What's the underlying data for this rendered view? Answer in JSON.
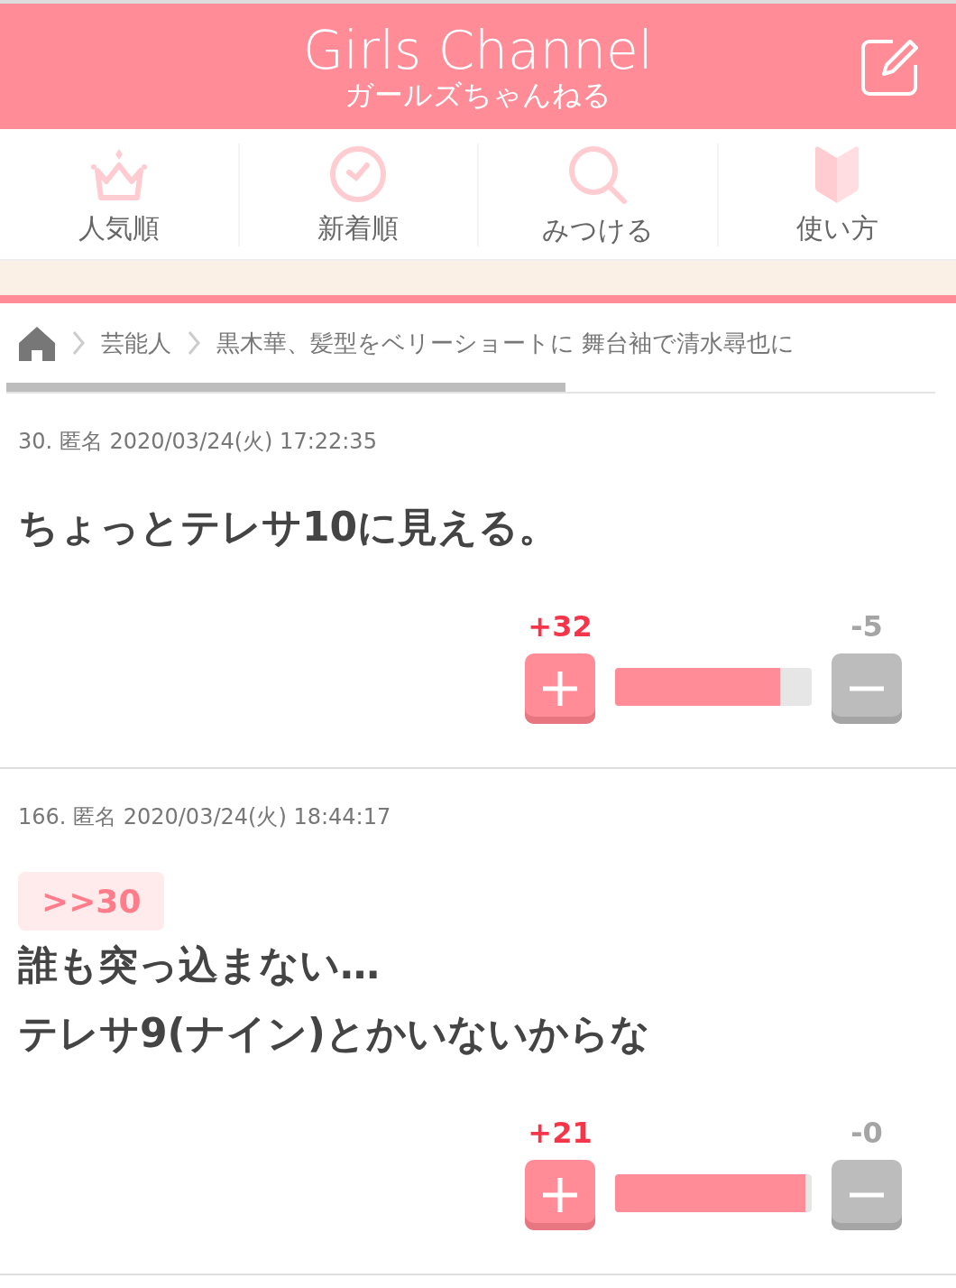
{
  "header": {
    "logo": "Girls Channel",
    "logo_sub": "ガールズちゃんねる"
  },
  "nav": [
    {
      "kind": "crown",
      "label": "人気順"
    },
    {
      "kind": "clock",
      "label": "新着順"
    },
    {
      "kind": "search",
      "label": "みつける"
    },
    {
      "kind": "book",
      "label": "使い方"
    }
  ],
  "breadcrumb": [
    "芸能人",
    "黒木華、髪型をベリーショートに 舞台袖で清水尋也に"
  ],
  "comments": [
    {
      "meta": "30. 匿名 2020/03/24(火) 17:22:35",
      "body": "ちょっとテレサ10に見える。",
      "plus": "+32",
      "minus": "-5",
      "level": 0.84
    },
    {
      "meta": "166. 匿名 2020/03/24(火) 18:44:17",
      "reply": ">>30",
      "body": "誰も突っ込まない…\nテレサ9(ナイン)とかいないからな",
      "plus": "+21",
      "minus": "-0",
      "level": 0.97
    }
  ]
}
